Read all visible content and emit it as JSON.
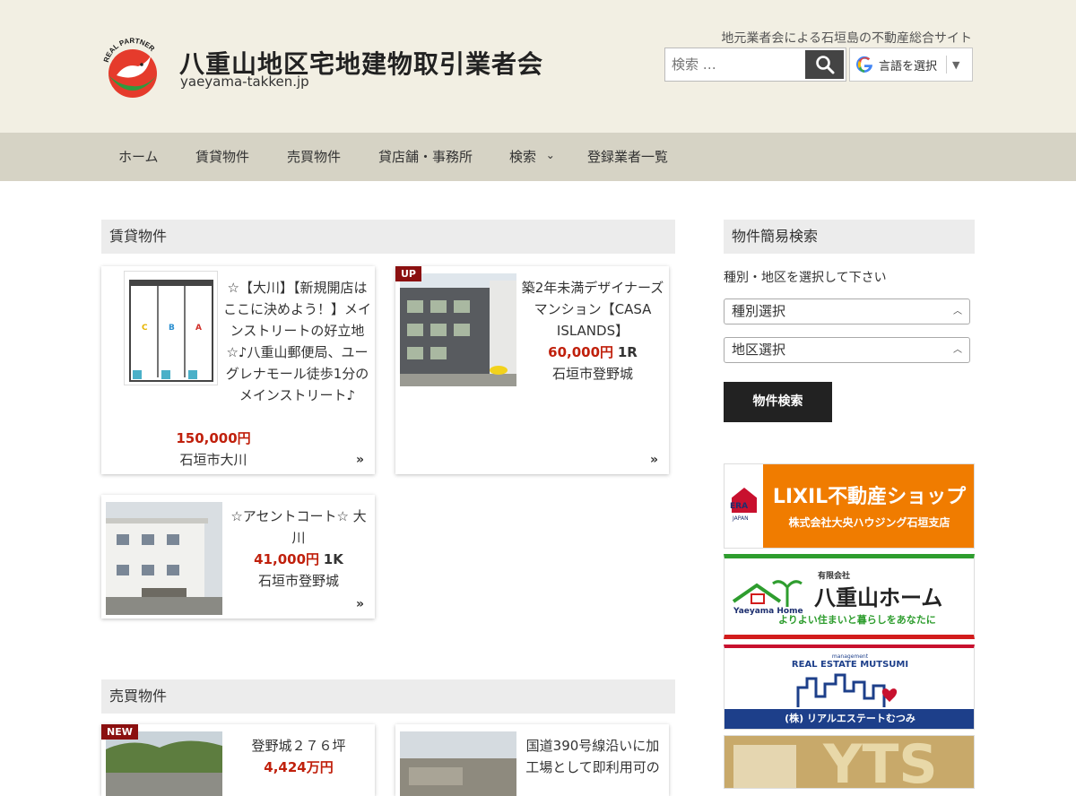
{
  "header": {
    "title": "八重山地区宅地建物取引業者会",
    "url": "yaeyama-takken.jp",
    "logo_text": "REAL PARTNER",
    "tagline": "地元業者会による石垣島の不動産総合サイト",
    "search_placeholder": "検索 …",
    "translate_label": "言語を選択",
    "translate_arrow": "▼"
  },
  "nav": {
    "items": [
      {
        "label": "ホーム"
      },
      {
        "label": "賃貸物件"
      },
      {
        "label": "売買物件"
      },
      {
        "label": "貸店舗・事務所"
      },
      {
        "label": "検索"
      },
      {
        "label": "登録業者一覧"
      }
    ],
    "dropdown_glyph": "⌄"
  },
  "rental": {
    "heading": "賃貸物件",
    "cards": [
      {
        "title": "☆【大川】【新規開店はここに決めよう！】メインストリートの好立地☆♪八重山郵便局、ユーグレナモール徒歩1分のメインストリート♪",
        "price": "150,000円",
        "layout": "",
        "location": "石垣市大川",
        "badge": ""
      },
      {
        "title": "築2年未満デザイナーズマンション【CASA ISLANDS】",
        "price": "60,000円",
        "layout": "1R",
        "location": "石垣市登野城",
        "badge": "UP"
      },
      {
        "title": "☆アセントコート☆ 大川",
        "price": "41,000円",
        "layout": "1K",
        "location": "石垣市登野城",
        "badge": ""
      }
    ],
    "floorplan_labels": [
      "C",
      "B",
      "A"
    ]
  },
  "sale": {
    "heading": "売買物件",
    "cards": [
      {
        "title": "登野城２７６坪",
        "price": "4,424万円",
        "badge": "NEW"
      },
      {
        "title": "国道390号線沿いに加工場として即利用可の",
        "price": "",
        "badge": ""
      }
    ]
  },
  "sidebar": {
    "heading": "物件簡易検索",
    "instruction": "種別・地区を選択して下さい",
    "type_select": "種別選択",
    "area_select": "地区選択",
    "submit_label": "物件検索",
    "banners": [
      {
        "main": "LIXIL不動産ショップ",
        "sub": "株式会社大央ハウジング石垣支店",
        "badge": "ERA",
        "badge_sub": "JAPAN",
        "color": "#f07c00"
      },
      {
        "main": "八重山ホーム",
        "prefix": "有限会社",
        "sub": "よりよい住まいと暮らしをあなたに",
        "en": "Yaeyama Home",
        "color": "#2e9d2e"
      },
      {
        "top": "management",
        "main": "REAL ESTATE MUTSUMI",
        "sub": "(株) リアルエステートむつみ",
        "color": "#1d3f8a"
      },
      {
        "main": "YTS",
        "color": "#c8a96a"
      }
    ]
  },
  "colors": {
    "header_bg": "#f2efe3",
    "nav_bg": "#d6d3c5",
    "price": "#c0200c",
    "badge": "#8b1010"
  }
}
